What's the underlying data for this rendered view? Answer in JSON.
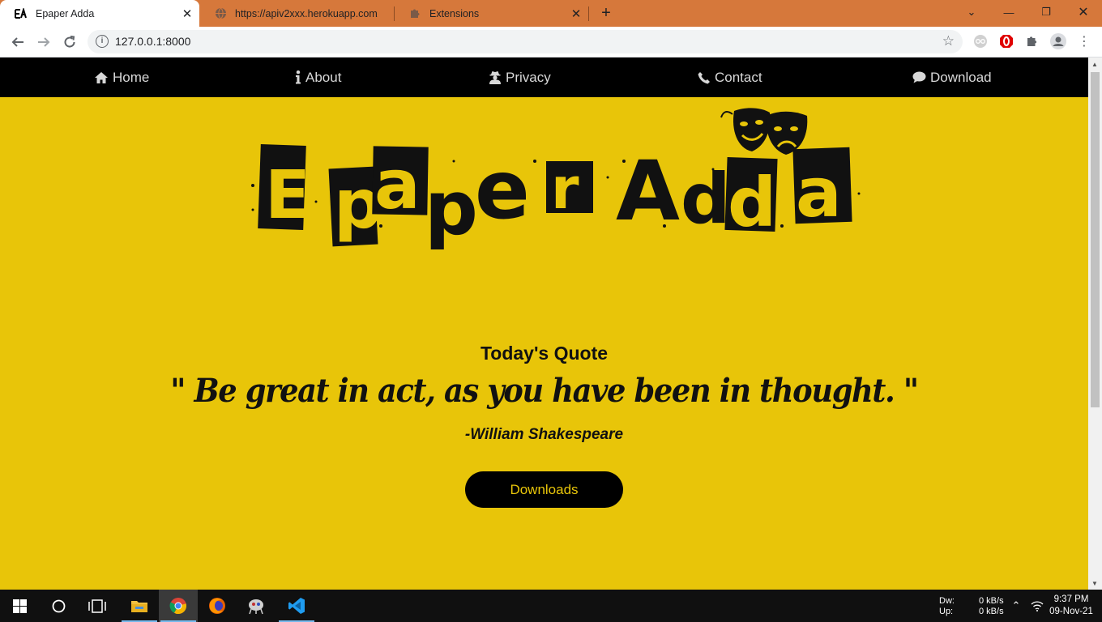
{
  "browser": {
    "tabs": [
      {
        "title": "Epaper Adda",
        "favicon": "epaper-adda-icon",
        "active": true
      },
      {
        "title": "https://apiv2xxx.herokuapp.com/",
        "favicon": "globe-icon",
        "active": false
      },
      {
        "title": "Extensions",
        "favicon": "puzzle-icon",
        "active": false
      }
    ],
    "url": "127.0.0.1:8000"
  },
  "site": {
    "nav": [
      {
        "label": "Home",
        "icon": "home-icon"
      },
      {
        "label": "About",
        "icon": "info-icon"
      },
      {
        "label": "Privacy",
        "icon": "user-secret-icon"
      },
      {
        "label": "Contact",
        "icon": "phone-icon"
      },
      {
        "label": "Download",
        "icon": "comment-icon"
      }
    ],
    "logo_text": "E paper Adda",
    "quote_heading": "Today's Quote",
    "quote_text": "\" Be great in act, as you have been in thought. \"",
    "quote_author": "-William Shakespeare",
    "download_button": "Downloads"
  },
  "colors": {
    "page_background": "#e8c509",
    "nav_background": "#000000",
    "tabstrip": "#d6783b"
  },
  "taskbar": {
    "net_down_label": "Dw:",
    "net_down_value": "0 kB/s",
    "net_up_label": "Up:",
    "net_up_value": "0 kB/s",
    "time": "9:37 PM",
    "date": "09-Nov-21"
  }
}
